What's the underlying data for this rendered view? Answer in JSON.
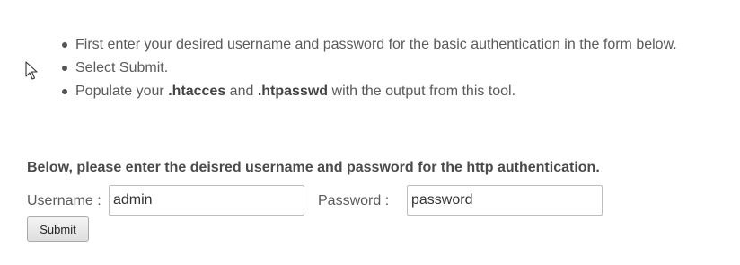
{
  "instructions": {
    "items": [
      {
        "text": "First enter your desired username and password for the basic authentication in the form below."
      },
      {
        "text": "Select Submit."
      },
      {
        "prefix": "Populate your ",
        "file1": ".htacces",
        "middle": " and ",
        "file2": ".htpasswd",
        "suffix": " with the output from this tool."
      }
    ]
  },
  "form": {
    "heading": "Below, please enter the deisred username and password for the http authentication.",
    "username_label": "Username :",
    "username_value": "admin",
    "password_label": "Password :",
    "password_value": "password",
    "submit_label": "Submit"
  },
  "cursor": {
    "icon": "mouse-pointer-icon"
  }
}
